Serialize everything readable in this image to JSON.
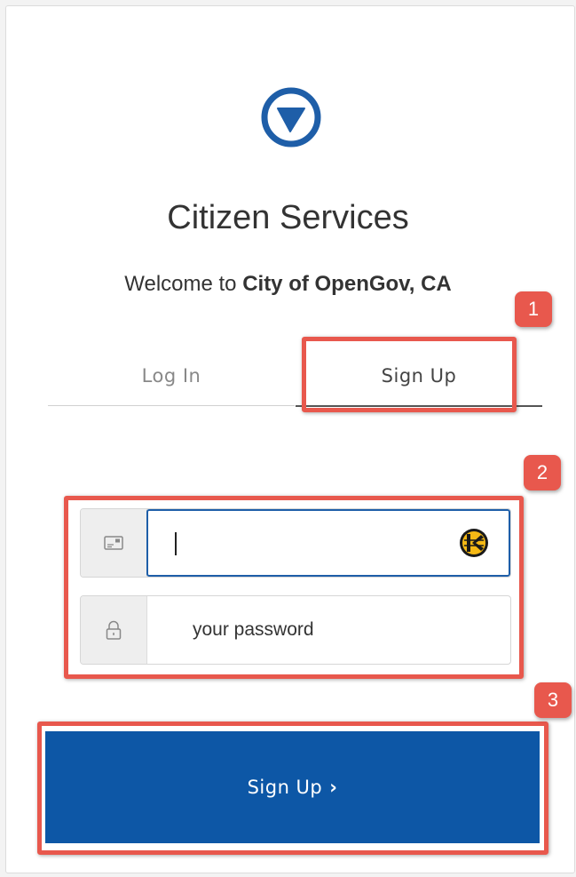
{
  "header": {
    "title": "Citizen Services",
    "welcome_prefix": "Welcome to ",
    "org_name": "City of OpenGov, CA"
  },
  "tabs": [
    {
      "label": "Log In",
      "active": false
    },
    {
      "label": "Sign Up",
      "active": true
    }
  ],
  "form": {
    "email": {
      "icon": "envelope-icon",
      "value": "",
      "focused": true
    },
    "password": {
      "icon": "lock-icon",
      "placeholder": "your password"
    },
    "submit_label": "Sign Up",
    "submit_chevron": "›"
  },
  "annotations": [
    "1",
    "2",
    "3"
  ],
  "colors": {
    "brand": "#1e5ea8",
    "button": "#0d57a6",
    "annotation": "#e8584d"
  }
}
